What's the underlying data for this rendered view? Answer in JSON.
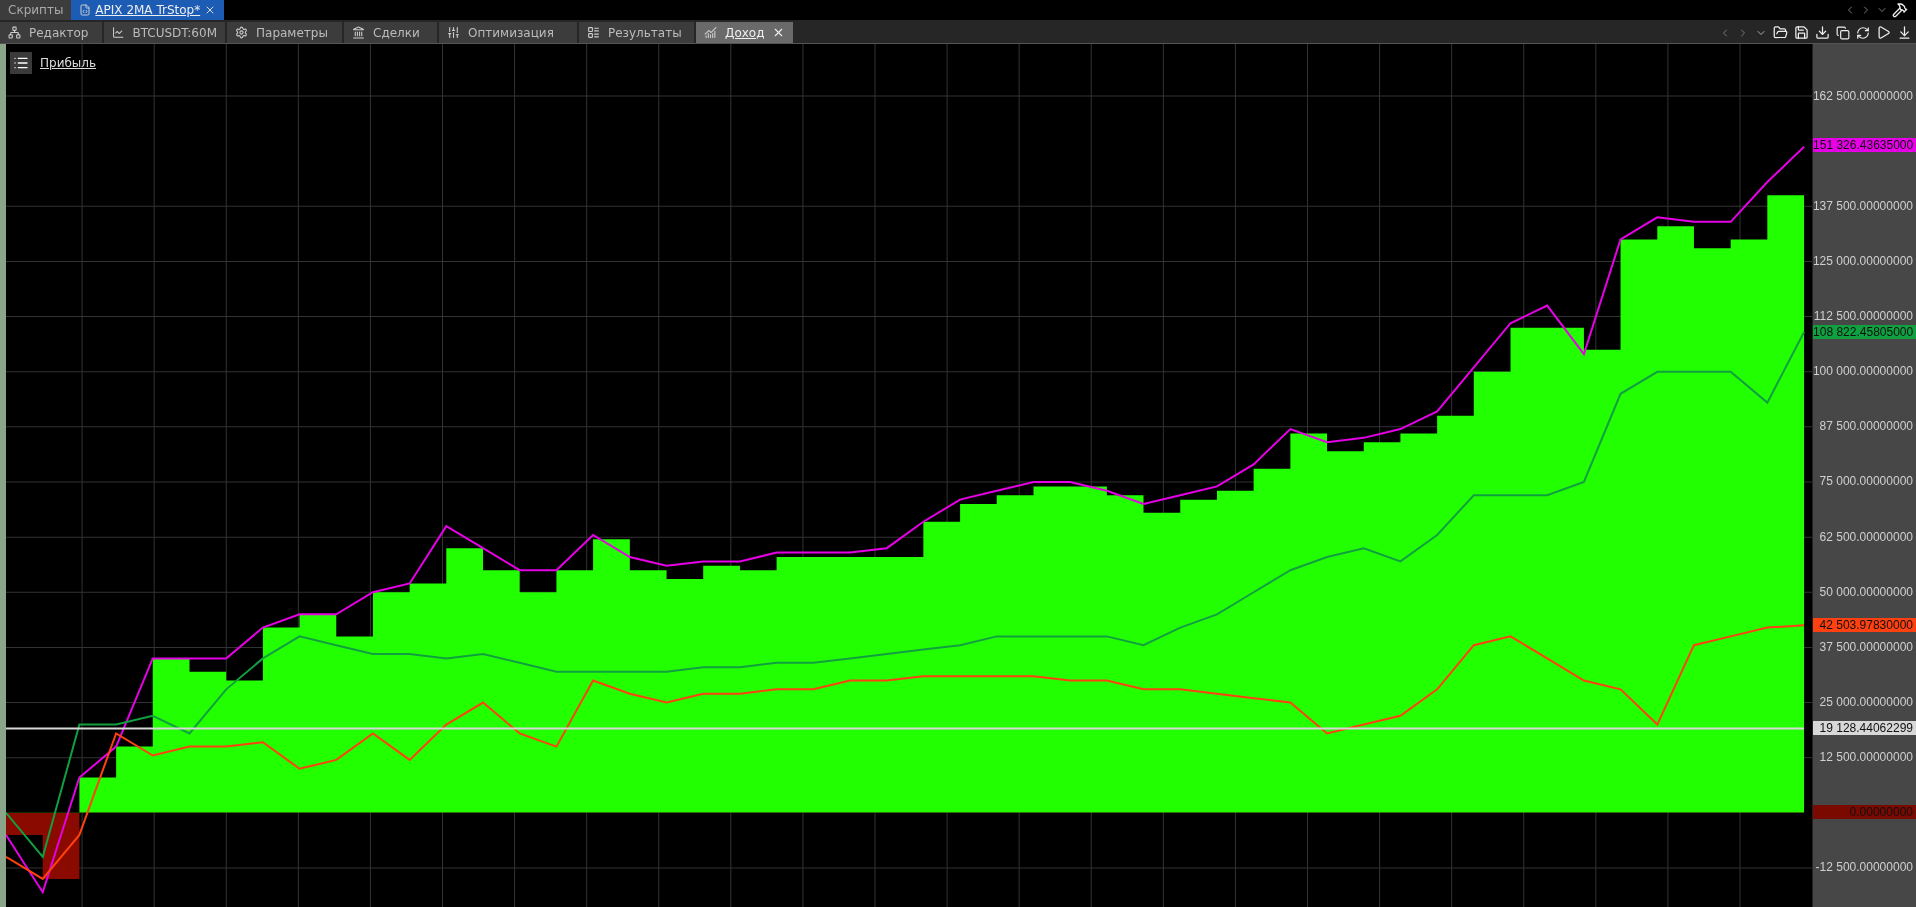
{
  "script_tabs": [
    {
      "label": "Скрипты",
      "selected": false,
      "closable": false
    },
    {
      "label": "APIX 2MA TrStop*",
      "selected": true,
      "closable": true
    }
  ],
  "tabs": [
    {
      "label": "Редактор",
      "selected": false,
      "closable": false
    },
    {
      "label": "BTCUSDT:60M",
      "selected": false,
      "closable": false
    },
    {
      "label": "Параметры",
      "selected": false,
      "closable": false
    },
    {
      "label": "Сделки",
      "selected": false,
      "closable": false
    },
    {
      "label": "Оптимизация",
      "selected": false,
      "closable": false
    },
    {
      "label": "Результаты",
      "selected": false,
      "closable": false
    },
    {
      "label": "Доход",
      "selected": true,
      "closable": true
    }
  ],
  "price_markers": [
    {
      "label": "151 326.43635000",
      "color": "#e600e6"
    },
    {
      "label": "108 822.45805000",
      "color": "#10a040"
    },
    {
      "label": "42 503.97830000",
      "color": "#ff4010"
    },
    {
      "label": "19 128.44062299",
      "color": "#d8d8d8"
    },
    {
      "label": "0.00000000",
      "color": "#7a0a00"
    }
  ],
  "chart_data": {
    "type": "area",
    "ylim": [
      -21350,
      174300
    ],
    "yticks": [
      {
        "value": 162500,
        "label": "162 500.00000000"
      },
      {
        "value": 137500,
        "label": "137 500.00000000"
      },
      {
        "value": 125000,
        "label": "125 000.00000000"
      },
      {
        "value": 112500,
        "label": "112 500.00000000"
      },
      {
        "value": 100000,
        "label": "100 000.00000000"
      },
      {
        "value": 87500,
        "label": "87 500.00000000"
      },
      {
        "value": 75000,
        "label": "75 000.00000000"
      },
      {
        "value": 62500,
        "label": "62 500.00000000"
      },
      {
        "value": 50000,
        "label": "50 000.00000000"
      },
      {
        "value": 37500,
        "label": "37 500.00000000"
      },
      {
        "value": 25000,
        "label": "25 000.00000000"
      },
      {
        "value": 12500,
        "label": "12 500.00000000"
      },
      {
        "value": -12500,
        "label": "-12 500.00000000"
      }
    ],
    "grid": true,
    "series": [
      {
        "name": "Прибыль",
        "color": "#22ff00",
        "values": [
          -5000,
          -15000,
          8000,
          15000,
          35000,
          32000,
          30000,
          42000,
          45000,
          40000,
          50000,
          52000,
          60000,
          55000,
          50000,
          55000,
          62000,
          55000,
          53000,
          56000,
          55000,
          58000,
          58000,
          58000,
          58000,
          66000,
          70000,
          72000,
          74000,
          74000,
          72000,
          68000,
          71000,
          73000,
          78000,
          86000,
          82000,
          84000,
          86000,
          90000,
          100000,
          110000,
          110000,
          105000,
          130000,
          133000,
          128000,
          130000,
          140000,
          151000
        ]
      },
      {
        "type": "line",
        "color": "#e600e6",
        "values": [
          -5000,
          -18000,
          8000,
          15000,
          35000,
          35000,
          35000,
          42000,
          45000,
          45000,
          50000,
          52000,
          65000,
          60000,
          55000,
          55000,
          63000,
          58000,
          56000,
          57000,
          57000,
          59000,
          59000,
          59000,
          60000,
          66000,
          71000,
          73000,
          75000,
          75000,
          73000,
          70000,
          72000,
          74000,
          79000,
          87000,
          84000,
          85000,
          87000,
          91000,
          101000,
          111000,
          115000,
          104000,
          130000,
          135000,
          134000,
          134000,
          143000,
          151000
        ]
      },
      {
        "type": "line",
        "color": "#10a040",
        "values": [
          0,
          -10000,
          20000,
          20000,
          22000,
          18000,
          28000,
          35000,
          40000,
          38000,
          36000,
          36000,
          35000,
          36000,
          34000,
          32000,
          32000,
          32000,
          32000,
          33000,
          33000,
          34000,
          34000,
          35000,
          36000,
          37000,
          38000,
          40000,
          40000,
          40000,
          40000,
          38000,
          42000,
          45000,
          50000,
          55000,
          58000,
          60000,
          57000,
          63000,
          72000,
          72000,
          72000,
          75000,
          95000,
          100000,
          100000,
          100000,
          93000,
          109000
        ]
      },
      {
        "type": "line",
        "color": "#ff4010",
        "values": [
          -10000,
          -15000,
          -5000,
          18000,
          13000,
          15000,
          15000,
          16000,
          10000,
          12000,
          18000,
          12000,
          20000,
          25000,
          18000,
          15000,
          30000,
          27000,
          25000,
          27000,
          27000,
          28000,
          28000,
          30000,
          30000,
          31000,
          31000,
          31000,
          31000,
          30000,
          30000,
          28000,
          28000,
          27000,
          26000,
          25000,
          18000,
          20000,
          22000,
          28000,
          38000,
          40000,
          35000,
          30000,
          28000,
          20000,
          38000,
          40000,
          42000,
          42500
        ]
      },
      {
        "type": "line",
        "color": "#d8d8d8",
        "values": [
          19128,
          19128,
          19128,
          19128,
          19128,
          19128,
          19128,
          19128,
          19128,
          19128,
          19128,
          19128,
          19128,
          19128,
          19128,
          19128,
          19128,
          19128,
          19128,
          19128,
          19128,
          19128,
          19128,
          19128,
          19128,
          19128,
          19128,
          19128,
          19128,
          19128,
          19128,
          19128,
          19128,
          19128,
          19128,
          19128,
          19128,
          19128,
          19128,
          19128,
          19128,
          19128,
          19128,
          19128,
          19128,
          19128,
          19128,
          19128,
          19128,
          19128
        ]
      }
    ]
  }
}
